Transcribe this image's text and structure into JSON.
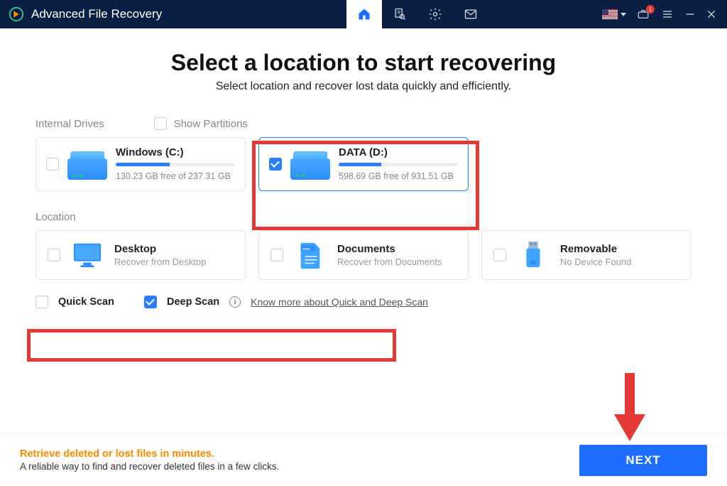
{
  "app": {
    "title": "Advanced File Recovery"
  },
  "titlebar": {
    "badge": "1"
  },
  "heading": "Select a location to start recovering",
  "subheading": "Select location and recover lost data quickly and efficiently.",
  "sections": {
    "drives_label": "Internal Drives",
    "show_partitions_label": "Show Partitions",
    "location_label": "Location"
  },
  "drives": [
    {
      "name": "Windows (C:)",
      "sub": "130.23 GB free of 237.31 GB",
      "fill_pct": 45,
      "checked": false
    },
    {
      "name": "DATA (D:)",
      "sub": "598.69 GB free of 931.51 GB",
      "fill_pct": 36,
      "checked": true
    }
  ],
  "locations": [
    {
      "title": "Desktop",
      "sub": "Recover from Desktop"
    },
    {
      "title": "Documents",
      "sub": "Recover from Documents"
    },
    {
      "title": "Removable",
      "sub": "No Device Found"
    }
  ],
  "scan": {
    "quick_label": "Quick Scan",
    "deep_label": "Deep Scan",
    "link": "Know more about Quick and Deep Scan",
    "quick_checked": false,
    "deep_checked": true
  },
  "footer": {
    "line1": "Retrieve deleted or lost files in minutes.",
    "line2": "A reliable way to find and recover deleted files in a few clicks.",
    "next": "NEXT"
  }
}
